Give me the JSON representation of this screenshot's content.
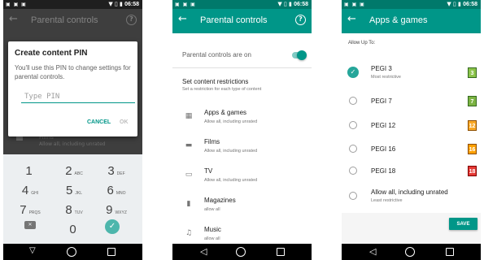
{
  "status": {
    "time": "06:58",
    "left_icons": "▣ ▣ ▣",
    "right_icons": "▼ ▯ ▮"
  },
  "phone1": {
    "title": "Parental controls",
    "dialog": {
      "title": "Create content PIN",
      "message": "You'll use this PIN to change settings for parental controls.",
      "placeholder": "Type PIN",
      "cancel": "CANCEL",
      "ok": "OK"
    },
    "ghost": {
      "title": "Films",
      "sub": "Allow all, including unrated"
    },
    "keys": [
      {
        "num": "1",
        "letters": ""
      },
      {
        "num": "2",
        "letters": "ABC"
      },
      {
        "num": "3",
        "letters": "DEF"
      },
      {
        "num": "4",
        "letters": "GHI"
      },
      {
        "num": "5",
        "letters": "JKL"
      },
      {
        "num": "6",
        "letters": "MNO"
      },
      {
        "num": "7",
        "letters": "PRQS"
      },
      {
        "num": "8",
        "letters": "TUV"
      },
      {
        "num": "9",
        "letters": "WXYZ"
      },
      {
        "num": "0",
        "letters": ""
      }
    ]
  },
  "phone2": {
    "title": "Parental controls",
    "status_text": "Parental controls are on",
    "toggle_on": true,
    "section_title": "Set content restrictions",
    "section_sub": "Set a restriction for each type of content",
    "rows": [
      {
        "icon": "apps-icon",
        "glyph": "▦",
        "title": "Apps & games",
        "sub": "Allow all, including unrated"
      },
      {
        "icon": "films-icon",
        "glyph": "▬",
        "title": "Films",
        "sub": "Allow all, including unrated"
      },
      {
        "icon": "tv-icon",
        "glyph": "▭",
        "title": "TV",
        "sub": "Allow all, including unrated"
      },
      {
        "icon": "magazines-icon",
        "glyph": "▮",
        "title": "Magazines",
        "sub": "allow all"
      },
      {
        "icon": "music-icon",
        "glyph": "♫",
        "title": "Music",
        "sub": "allow all"
      }
    ]
  },
  "phone3": {
    "title": "Apps & games",
    "allow_label": "Allow Up To:",
    "ratings": [
      {
        "name": "PEGI 3",
        "sub": "Most restrictive",
        "badge": "3",
        "color": "#8bc34a",
        "checked": true
      },
      {
        "name": "PEGI 7",
        "sub": "",
        "badge": "7",
        "color": "#7cb342",
        "checked": false
      },
      {
        "name": "PEGI 12",
        "sub": "",
        "badge": "12",
        "color": "#f9a825",
        "checked": false
      },
      {
        "name": "PEGI 16",
        "sub": "",
        "badge": "16",
        "color": "#ffa000",
        "checked": false
      },
      {
        "name": "PEGI 18",
        "sub": "",
        "badge": "18",
        "color": "#e53935",
        "checked": false
      },
      {
        "name": "Allow all, including unrated",
        "sub": "Least restrictive",
        "badge": "",
        "color": "",
        "checked": false
      }
    ],
    "save": "SAVE"
  },
  "colors": {
    "teal": "#009688",
    "teal_dark": "#00796b"
  }
}
